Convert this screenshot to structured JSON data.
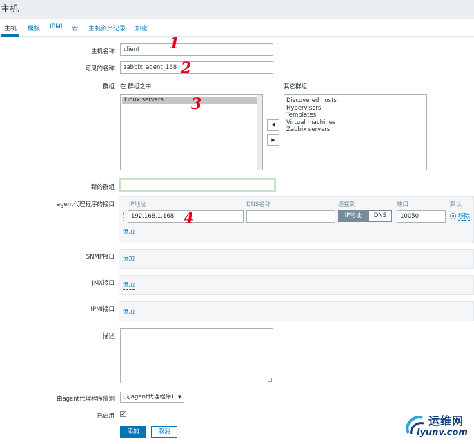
{
  "page": {
    "title": "主机"
  },
  "tabs": [
    {
      "label": "主机",
      "active": true
    },
    {
      "label": "模板"
    },
    {
      "label": "IPMI"
    },
    {
      "label": "宏"
    },
    {
      "label": "主机资产记录"
    },
    {
      "label": "加密"
    }
  ],
  "form": {
    "hostname": {
      "label": "主机名称",
      "value": "client"
    },
    "visible_name": {
      "label": "可见的名称",
      "value": "zabbix_agent_168"
    },
    "groups": {
      "label": "群组",
      "in_groups_label": "在 群组之中",
      "other_groups_label": "其它群组",
      "in_groups": [
        "Linux servers"
      ],
      "other_groups": [
        "Discovered hosts",
        "Hypervisors",
        "Templates",
        "Virtual machines",
        "Zabbix servers"
      ],
      "move_left": "◀",
      "move_right": "▶"
    },
    "new_group": {
      "label": "新的群组",
      "value": ""
    },
    "agent_interfaces": {
      "label": "agent代理程序的接口",
      "headers": {
        "ip": "IP地址",
        "dns": "DNS名称",
        "connect": "连接到",
        "port": "端口",
        "default": "默认"
      },
      "row": {
        "ip": "192.168.1.168",
        "dns": "",
        "connect_ip": "IP地址",
        "connect_dns": "DNS",
        "port": "10050",
        "remove": "移除"
      },
      "add": "添加"
    },
    "snmp": {
      "label": "SNMP接口",
      "add": "添加"
    },
    "jmx": {
      "label": "JMX接口",
      "add": "添加"
    },
    "ipmi": {
      "label": "IPMI接口",
      "add": "添加"
    },
    "description": {
      "label": "描述",
      "value": ""
    },
    "proxy": {
      "label": "由agent代理程序监测",
      "value": "(无agent代理程序)",
      "caret": "▼"
    },
    "enabled": {
      "label": "已启用",
      "checked": true,
      "mark": "✔"
    }
  },
  "buttons": {
    "add": "添加",
    "cancel": "取消"
  },
  "annotations": [
    "1",
    "2",
    "3",
    "4"
  ],
  "watermark": {
    "cn": "运维网",
    "en": "iyunv.com"
  },
  "colors": {
    "accent": "#0275b8",
    "annotation": "#e2001a",
    "segment": "#768d99"
  }
}
